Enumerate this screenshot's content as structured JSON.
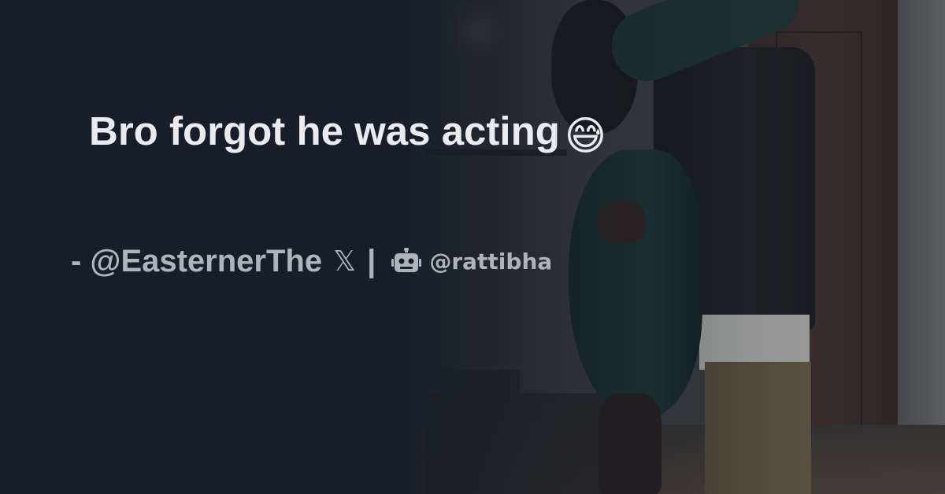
{
  "post": {
    "text": "Bro forgot he was acting",
    "emoji": "😅"
  },
  "byline": {
    "author": "- @EasternerThe",
    "platform_glyph": "𝕏",
    "separator": "|",
    "site": "@rattibha"
  },
  "icons": {
    "emoji_name": "grinning-face-with-sweat-icon",
    "platform": "x-logo-icon",
    "site": "robot-icon"
  },
  "colors": {
    "background": "#151e29",
    "headline": "#e9ebee",
    "byline": "#aeb4bc"
  }
}
